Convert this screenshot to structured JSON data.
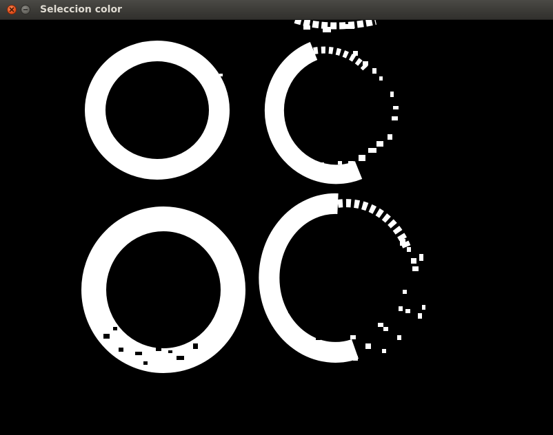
{
  "window": {
    "title": "Seleccion color",
    "controls": [
      {
        "name": "close",
        "icon": "close-icon",
        "color": "#e95420"
      },
      {
        "name": "minimize",
        "icon": "minimize-icon",
        "color": "#66655f"
      }
    ]
  },
  "image": {
    "description_icon": "binary-mask-image",
    "foreground_color": "#ffffff",
    "background_color": "#000000"
  }
}
